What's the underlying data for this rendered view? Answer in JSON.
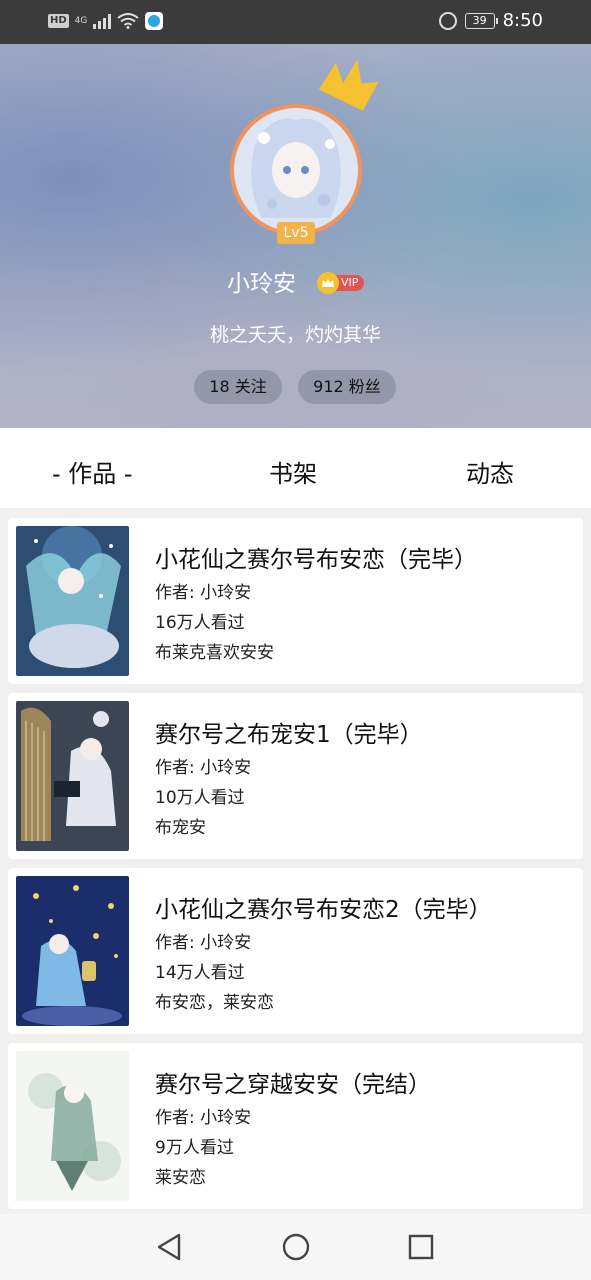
{
  "status_bar": {
    "network_badge": "HD",
    "network_type": "4G",
    "battery": "39",
    "time": "8:50"
  },
  "profile": {
    "level": "Lv5",
    "username": "小玲安",
    "vip_label": "VIP",
    "motto": "桃之夭夭，灼灼其华",
    "following": "18 关注",
    "fans": "912 粉丝"
  },
  "tabs": [
    {
      "label": "- 作品 -",
      "active": true
    },
    {
      "label": "书架",
      "active": false
    },
    {
      "label": "动态",
      "active": false
    }
  ],
  "works": [
    {
      "title": "小花仙之赛尔号布安恋（完毕）",
      "author": "作者: 小玲安",
      "views": "16万人看过",
      "tags": "布莱克喜欢安安",
      "cover_colors": [
        "#2d4d73",
        "#8fd3e0",
        "#cfd9ea"
      ]
    },
    {
      "title": "赛尔号之布宠安1（完毕）",
      "author": "作者: 小玲安",
      "views": "10万人看过",
      "tags": "布宠安",
      "cover_colors": [
        "#3c4554",
        "#c8a35f",
        "#e3e6ee"
      ]
    },
    {
      "title": "小花仙之赛尔号布安恋2（完毕）",
      "author": "作者: 小玲安",
      "views": "14万人看过",
      "tags": "布安恋，莱安恋",
      "cover_colors": [
        "#1b2d6b",
        "#f2d46a",
        "#7fb9e6"
      ]
    },
    {
      "title": "赛尔号之穿越安安（完结）",
      "author": "作者: 小玲安",
      "views": "9万人看过",
      "tags": "莱安恋",
      "cover_colors": [
        "#f4f6f2",
        "#7fa89a",
        "#cfe0d6"
      ]
    }
  ],
  "colors": {
    "avatar_ring": "#f3925c",
    "level_badge": "#f2b34b",
    "vip_red": "#e65451",
    "crown": "#f5c12f"
  },
  "nav_icons": [
    "back-triangle-icon",
    "home-circle-icon",
    "recents-square-icon"
  ]
}
